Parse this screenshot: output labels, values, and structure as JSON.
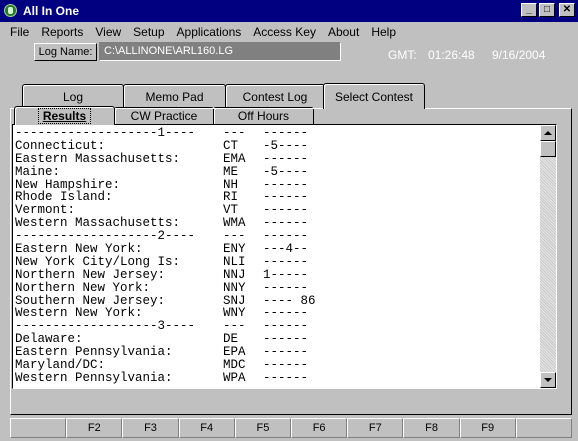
{
  "window": {
    "title": "All In One",
    "minimize_glyph": "_",
    "maximize_glyph": "□",
    "close_glyph": "✕"
  },
  "menu": [
    "File",
    "Reports",
    "View",
    "Setup",
    "Applications",
    "Access Key",
    "About",
    "Help"
  ],
  "log": {
    "button_label": "Log Name:",
    "path": "C:\\ALLINONE\\ARL160.LG"
  },
  "status": {
    "gmt_label": "GMT:",
    "time": "01:26:48",
    "date": "9/16/2004"
  },
  "tabs_main": [
    "Log",
    "Memo Pad",
    "Contest Log",
    "Select Contest"
  ],
  "tabs_main_selected": "Select Contest",
  "tabs_sub": [
    "Results",
    "CW Practice",
    "Off Hours"
  ],
  "tabs_sub_selected": "Results",
  "results": [
    {
      "name": "-------------------1----",
      "abbr": "---",
      "value": "------"
    },
    {
      "name": "Connecticut:",
      "abbr": "CT",
      "value": "-5----"
    },
    {
      "name": "Eastern Massachusetts:",
      "abbr": "EMA",
      "value": "------"
    },
    {
      "name": "Maine:",
      "abbr": "ME",
      "value": "-5----"
    },
    {
      "name": "New Hampshire:",
      "abbr": "NH",
      "value": "------"
    },
    {
      "name": "Rhode Island:",
      "abbr": "RI",
      "value": "------"
    },
    {
      "name": "Vermont:",
      "abbr": "VT",
      "value": "------"
    },
    {
      "name": "Western Massachusetts:",
      "abbr": "WMA",
      "value": "------"
    },
    {
      "name": "-------------------2----",
      "abbr": "---",
      "value": "------"
    },
    {
      "name": "Eastern New York:",
      "abbr": "ENY",
      "value": "---4--"
    },
    {
      "name": "New York City/Long Is:",
      "abbr": "NLI",
      "value": "------"
    },
    {
      "name": "Northern New Jersey:",
      "abbr": "NNJ",
      "value": "1-----"
    },
    {
      "name": "Northern New York:",
      "abbr": "NNY",
      "value": "------"
    },
    {
      "name": "Southern New Jersey:",
      "abbr": "SNJ",
      "value": "---- 86"
    },
    {
      "name": "Western New York:",
      "abbr": "WNY",
      "value": "------"
    },
    {
      "name": "-------------------3----",
      "abbr": "---",
      "value": "------"
    },
    {
      "name": "Delaware:",
      "abbr": "DE",
      "value": "------"
    },
    {
      "name": "Eastern Pennsylvania:",
      "abbr": "EPA",
      "value": "------"
    },
    {
      "name": "Maryland/DC:",
      "abbr": "MDC",
      "value": "------"
    },
    {
      "name": "Western Pennsylvania:",
      "abbr": "WPA",
      "value": "------"
    }
  ],
  "function_keys": [
    "",
    "F2",
    "F3",
    "F4",
    "F5",
    "F6",
    "F7",
    "F8",
    "F9",
    ""
  ],
  "colors": {
    "titlebar": "#000080",
    "face": "#c0c0c0",
    "path_field": "#808080"
  }
}
